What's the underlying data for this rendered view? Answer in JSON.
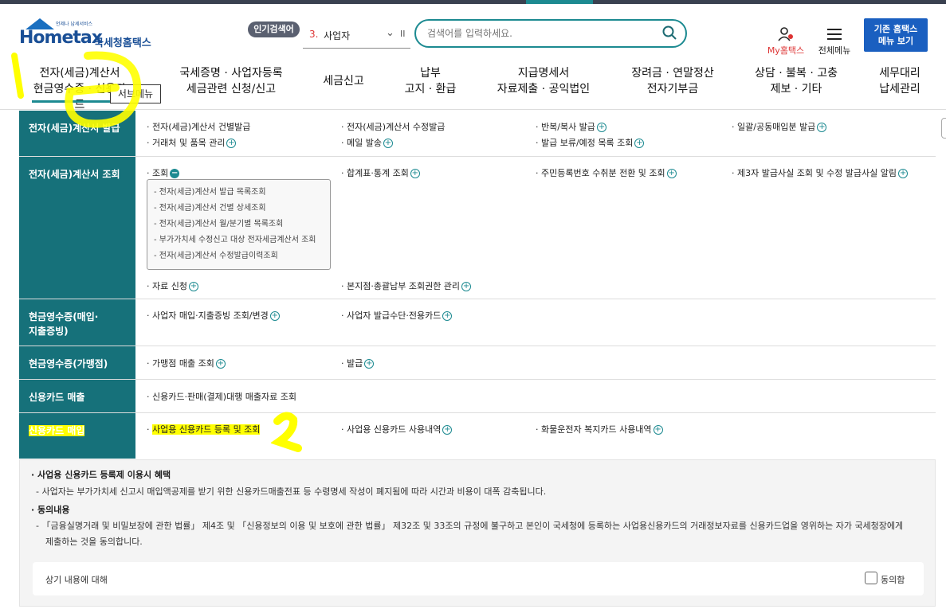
{
  "header": {
    "logo_small": "언제나 납세서비스",
    "logo_word": "Hometax",
    "logo_kor": "국세청홈택스",
    "popular_badge": "인기검색어",
    "popular_rank": "3.",
    "popular_term": "사업자",
    "search_placeholder": "검색어를 입력하세요.",
    "my_hometax": "My홈택스",
    "all_menu": "전체메뉴",
    "classic_line1": "기존 홈택스",
    "classic_line2": "메뉴 보기"
  },
  "gnb": [
    {
      "line1": "전자(세금)계산서",
      "line2": "현금영수증 · 신용카드"
    },
    {
      "line1": "국세증명 · 사업자등록",
      "line2": "세금관련 신청/신고"
    },
    {
      "line1": "세금신고",
      "line2": ""
    },
    {
      "line1": "납부",
      "line2": "고지 · 환급"
    },
    {
      "line1": "지급명세서",
      "line2": "자료제출 · 공익법인"
    },
    {
      "line1": "장려금 · 연말정산",
      "line2": "전자기부금"
    },
    {
      "line1": "상담 · 불복 · 고충",
      "line2": "제보 · 기타"
    },
    {
      "line1": "세무대리",
      "line2": "납세관리"
    }
  ],
  "submenu_tooltip": "서브메뉴",
  "rows": [
    {
      "head": "전자(세금)계산서 발급",
      "items": [
        "전자(세금)계산서 건별발급",
        "전자(세금)계산서 수정발급",
        "반복/복사 발급",
        "일괄/공동매입분 발급",
        "거래처 및 품목 관리",
        "메일 발송",
        "발급 보류/예정 목록 조회"
      ]
    },
    {
      "head": "전자(세금)계산서 조회",
      "items": [
        "조회",
        "합계표·통계 조회",
        "주민등록번호 수취분 전환 및 조회",
        "제3자 발급사실 조회 및 수정 발급사실 알림",
        "자료 신청",
        "본지점·총괄납부 조회권한 관리"
      ],
      "sub": [
        "- 전자(세금)계산서 발급 목록조회",
        "- 전자(세금)계산서 건별 상세조회",
        "- 전자(세금)계산서 월/분기별 목록조회",
        "- 부가가치세 수정신고 대상 전자세금계산서 조회",
        "- 전자(세금)계산서 수정발급이력조회"
      ]
    },
    {
      "head_line1": "현금영수증(매입·",
      "head_line2": "지출증빙)",
      "items": [
        "사업자 매입·지출증빙 조회/변경",
        "사업자 발급수단·전용카드"
      ]
    },
    {
      "head": "현금영수증(가맹점)",
      "items": [
        "가맹점 매출 조회",
        "발급"
      ]
    },
    {
      "head": "신용카드 매출",
      "items": [
        "신용카드·판매(결제)대행 매출자료 조회"
      ]
    },
    {
      "head": "신용카드 매입",
      "items": [
        "사업용 신용카드 등록 및 조회",
        "사업용 신용카드 사용내역",
        "화물운전자 복지카드 사용내역"
      ]
    }
  ],
  "notice": {
    "title1": "사업용 신용카드 등록제 이용시 혜택",
    "text1": "- 사업자는 부가가치세 신고시 매입액공제를 받기 위한 신용카드매출전표 등 수령명세 작성이 폐지됨에 따라 시간과 비용이 대폭 감축됩니다.",
    "title2": "동의내용",
    "text2a": "- 「금융실명거래 및 비밀보장에 관한 법률」 제4조 및 「신용정보의 이용 및 보호에 관한 법률」 제32조 및 33조의 규정에 불구하고 본인이 국세청에 등록하는 사업용신용카드의   거래정보자료를 신용카드업을 영위하는 자가 국세청장에게",
    "text2b": "제출하는 것을 동의합니다.",
    "agree_label": "상기 내용에 대해",
    "agree_text": "동의함"
  },
  "colors": {
    "accent": "#1c8a91",
    "head_bg": "#16717a",
    "brand": "#1a4f96",
    "highlight": "#ffff00"
  },
  "annotations": [
    "1",
    "2"
  ]
}
